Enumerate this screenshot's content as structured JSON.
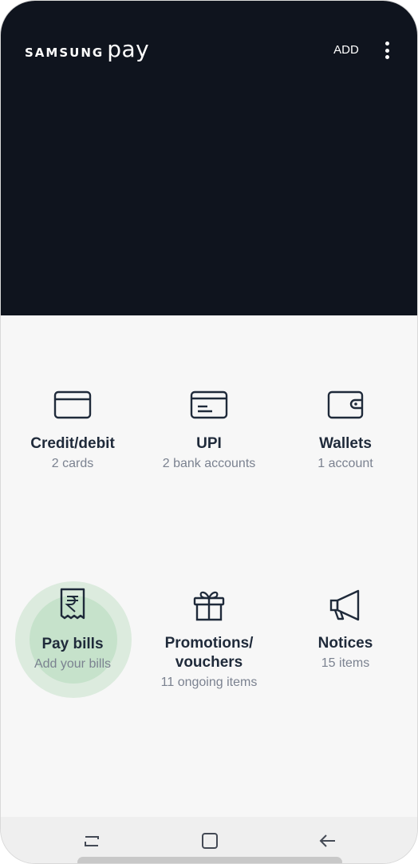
{
  "header": {
    "logo_samsung": "SAMSUNG",
    "logo_pay": "pay",
    "add_label": "ADD",
    "more_icon": "more-vertical-icon",
    "background_color": "#0f141e"
  },
  "tiles": [
    {
      "title": "Credit/debit",
      "subtitle": "2 cards",
      "icon": "credit-card-icon"
    },
    {
      "title": "UPI",
      "subtitle": "2 bank accounts",
      "icon": "bank-card-icon"
    },
    {
      "title": "Wallets",
      "subtitle": "1 account",
      "icon": "wallet-icon"
    },
    {
      "title": "Pay bills",
      "subtitle": "Add your bills",
      "icon": "rupee-receipt-icon",
      "highlighted": true
    },
    {
      "title_line1": "Promotions/",
      "title_line2": "vouchers",
      "subtitle": "11 ongoing items",
      "icon": "gift-icon"
    },
    {
      "title": "Notices",
      "subtitle": "15 items",
      "icon": "megaphone-icon"
    }
  ],
  "navbar": {
    "recents_icon": "recents-icon",
    "home_icon": "home-icon",
    "back_icon": "back-icon"
  },
  "colors": {
    "title_text": "#1f2a3a",
    "subtitle_text": "#7b8290",
    "highlight": "#c6e2cb"
  }
}
